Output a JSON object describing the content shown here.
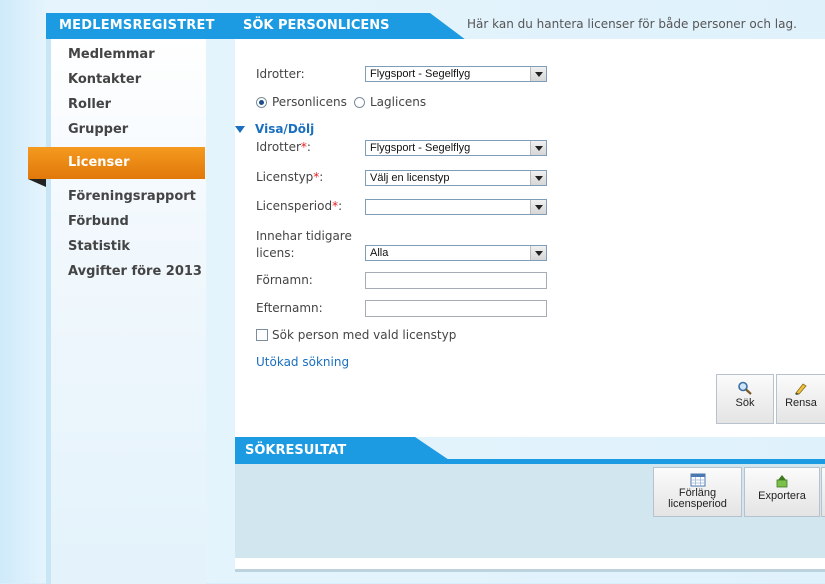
{
  "sidebar": {
    "header": "MEDLEMSREGISTRET",
    "items": [
      "Medlemmar",
      "Kontakter",
      "Roller",
      "Grupper"
    ],
    "active": "Licenser",
    "items2": [
      "Föreningsrapport",
      "Förbund",
      "Statistik",
      "Avgifter före 2013"
    ]
  },
  "header": {
    "title": "SÖK PERSONLICENS",
    "description": "Här kan du hantera licenser för både personer och lag."
  },
  "form": {
    "idrotter_label": "Idrotter:",
    "idrotter_value": "Flygsport - Segelflyg",
    "radio_person": "Personlicens",
    "radio_lag": "Laglicens",
    "toggle": "Visa/Dölj",
    "idrotter2_label": "Idrotter",
    "idrotter2_value": "Flygsport - Segelflyg",
    "licenstyp_label": "Licenstyp",
    "licenstyp_value": "Välj en licenstyp",
    "licensperiod_label": "Licensperiod",
    "licensperiod_value": "",
    "innehar_label_1": "Innehar tidigare",
    "innehar_label_2": "licens:",
    "innehar_value": "Alla",
    "fornamn_label": "Förnamn:",
    "efternamn_label": "Efternamn:",
    "checkbox_label": "Sök person med vald licenstyp",
    "extended_link": "Utökad sökning",
    "required_mark": "*",
    "colon": ":"
  },
  "buttons": {
    "search": "Sök",
    "clear": "Rensa"
  },
  "results": {
    "title": "SÖKRESULTAT",
    "extend_line1": "Förläng",
    "extend_line2": "licensperiod",
    "export": "Exportera"
  }
}
